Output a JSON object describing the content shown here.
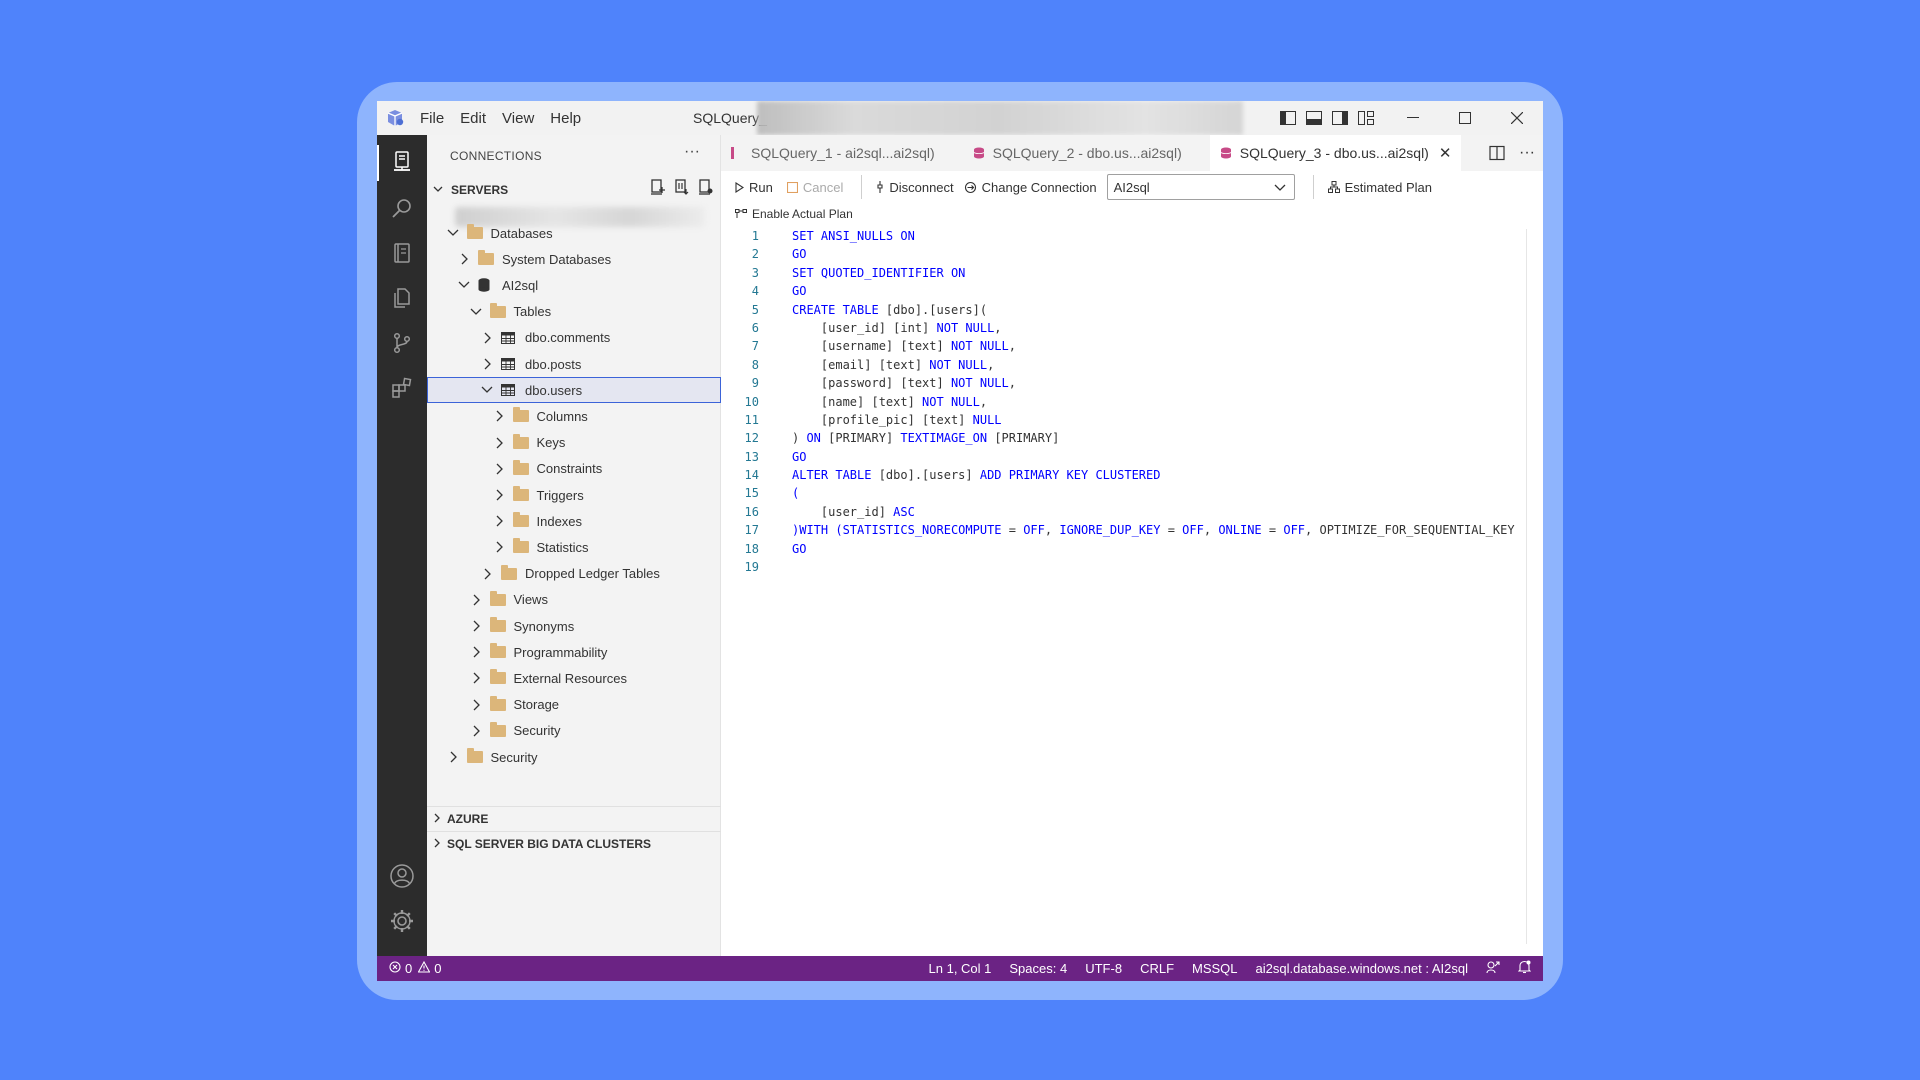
{
  "title_bar": {
    "menu": [
      "File",
      "Edit",
      "View",
      "Help"
    ],
    "title": "SQLQuery_"
  },
  "sidebar": {
    "header": "CONNECTIONS",
    "servers_title": "SERVERS",
    "tree": [
      {
        "label": "Databases",
        "depth": 1,
        "expanded": true,
        "icon": "folder"
      },
      {
        "label": "System Databases",
        "depth": 2,
        "expanded": false,
        "icon": "folder"
      },
      {
        "label": "AI2sql",
        "depth": 2,
        "expanded": true,
        "icon": "database"
      },
      {
        "label": "Tables",
        "depth": 3,
        "expanded": true,
        "icon": "folder"
      },
      {
        "label": "dbo.comments",
        "depth": 4,
        "expanded": false,
        "icon": "table"
      },
      {
        "label": "dbo.posts",
        "depth": 4,
        "expanded": false,
        "icon": "table"
      },
      {
        "label": "dbo.users",
        "depth": 4,
        "expanded": true,
        "icon": "table",
        "selected": true
      },
      {
        "label": "Columns",
        "depth": 5,
        "expanded": false,
        "icon": "folder"
      },
      {
        "label": "Keys",
        "depth": 5,
        "expanded": false,
        "icon": "folder"
      },
      {
        "label": "Constraints",
        "depth": 5,
        "expanded": false,
        "icon": "folder"
      },
      {
        "label": "Triggers",
        "depth": 5,
        "expanded": false,
        "icon": "folder"
      },
      {
        "label": "Indexes",
        "depth": 5,
        "expanded": false,
        "icon": "folder"
      },
      {
        "label": "Statistics",
        "depth": 5,
        "expanded": false,
        "icon": "folder"
      },
      {
        "label": "Dropped Ledger Tables",
        "depth": 4,
        "expanded": false,
        "icon": "folder"
      },
      {
        "label": "Views",
        "depth": 3,
        "expanded": false,
        "icon": "folder"
      },
      {
        "label": "Synonyms",
        "depth": 3,
        "expanded": false,
        "icon": "folder"
      },
      {
        "label": "Programmability",
        "depth": 3,
        "expanded": false,
        "icon": "folder"
      },
      {
        "label": "External Resources",
        "depth": 3,
        "expanded": false,
        "icon": "folder"
      },
      {
        "label": "Storage",
        "depth": 3,
        "expanded": false,
        "icon": "folder"
      },
      {
        "label": "Security",
        "depth": 3,
        "expanded": false,
        "icon": "folder"
      },
      {
        "label": "Security",
        "depth": 1,
        "expanded": false,
        "icon": "folder"
      }
    ],
    "footer_sections": [
      "AZURE",
      "SQL SERVER BIG DATA CLUSTERS"
    ]
  },
  "tabs": [
    {
      "label": "SQLQuery_1 - ai2sql...ai2sql)",
      "active": false
    },
    {
      "label": "SQLQuery_2 - dbo.us...ai2sql)",
      "active": false
    },
    {
      "label": "SQLQuery_3 - dbo.us...ai2sql)",
      "active": true
    }
  ],
  "toolbar": {
    "run": "Run",
    "cancel": "Cancel",
    "disconnect": "Disconnect",
    "change_connection": "Change Connection",
    "database": "AI2sql",
    "estimated_plan": "Estimated Plan",
    "enable_actual_plan": "Enable Actual Plan"
  },
  "code_lines": [
    [
      {
        "t": "SET ANSI_NULLS ON",
        "k": true
      }
    ],
    [
      {
        "t": "GO",
        "k": true
      }
    ],
    [
      {
        "t": "SET QUOTED_IDENTIFIER ON",
        "k": true
      }
    ],
    [
      {
        "t": "GO",
        "k": true
      }
    ],
    [
      {
        "t": "CREATE TABLE ",
        "k": true
      },
      {
        "t": "[dbo].[users](",
        "k": false
      }
    ],
    [
      {
        "t": "    [user_id] [int] ",
        "k": false
      },
      {
        "t": "NOT NULL",
        "k": true
      },
      {
        "t": ",",
        "k": false
      }
    ],
    [
      {
        "t": "    [username] [text] ",
        "k": false
      },
      {
        "t": "NOT NULL",
        "k": true
      },
      {
        "t": ",",
        "k": false
      }
    ],
    [
      {
        "t": "    [email] [text] ",
        "k": false
      },
      {
        "t": "NOT NULL",
        "k": true
      },
      {
        "t": ",",
        "k": false
      }
    ],
    [
      {
        "t": "    [password] [text] ",
        "k": false
      },
      {
        "t": "NOT NULL",
        "k": true
      },
      {
        "t": ",",
        "k": false
      }
    ],
    [
      {
        "t": "    [name] [text] ",
        "k": false
      },
      {
        "t": "NOT NULL",
        "k": true
      },
      {
        "t": ",",
        "k": false
      }
    ],
    [
      {
        "t": "    [profile_pic] [text] ",
        "k": false
      },
      {
        "t": "NULL",
        "k": true
      }
    ],
    [
      {
        "t": ") ",
        "k": false
      },
      {
        "t": "ON ",
        "k": true
      },
      {
        "t": "[PRIMARY] ",
        "k": false
      },
      {
        "t": "TEXTIMAGE_ON ",
        "k": true
      },
      {
        "t": "[PRIMARY]",
        "k": false
      }
    ],
    [
      {
        "t": "GO",
        "k": true
      }
    ],
    [
      {
        "t": "ALTER TABLE ",
        "k": true
      },
      {
        "t": "[dbo].[users] ",
        "k": false
      },
      {
        "t": "ADD PRIMARY KEY CLUSTERED",
        "k": true
      }
    ],
    [
      {
        "t": "(",
        "k": true
      }
    ],
    [
      {
        "t": "    [user_id] ",
        "k": false
      },
      {
        "t": "ASC",
        "k": true
      }
    ],
    [
      {
        "t": ")WITH (STATISTICS_NORECOMPUTE ",
        "k": true
      },
      {
        "t": "= ",
        "k": false
      },
      {
        "t": "OFF",
        "k": true
      },
      {
        "t": ", ",
        "k": false
      },
      {
        "t": "IGNORE_DUP_KEY ",
        "k": true
      },
      {
        "t": "= ",
        "k": false
      },
      {
        "t": "OFF",
        "k": true
      },
      {
        "t": ", ",
        "k": false
      },
      {
        "t": "ONLINE ",
        "k": true
      },
      {
        "t": "= ",
        "k": false
      },
      {
        "t": "OFF",
        "k": true
      },
      {
        "t": ", OPTIMIZE_FOR_SEQUENTIAL_KEY",
        "k": false
      }
    ],
    [
      {
        "t": "GO",
        "k": true
      }
    ],
    [
      {
        "t": "",
        "k": false
      }
    ]
  ],
  "status": {
    "errors": "0",
    "warnings": "0",
    "position": "Ln 1, Col 1",
    "spaces": "Spaces: 4",
    "encoding": "UTF-8",
    "eol": "CRLF",
    "language": "MSSQL",
    "connection": "ai2sql.database.windows.net : AI2sql"
  },
  "colors": {
    "background": "#4f83fb",
    "statusbar": "#6b2384",
    "activitybar": "#2c2c2c",
    "keyword": "#0000ff",
    "line_number": "#237893"
  }
}
